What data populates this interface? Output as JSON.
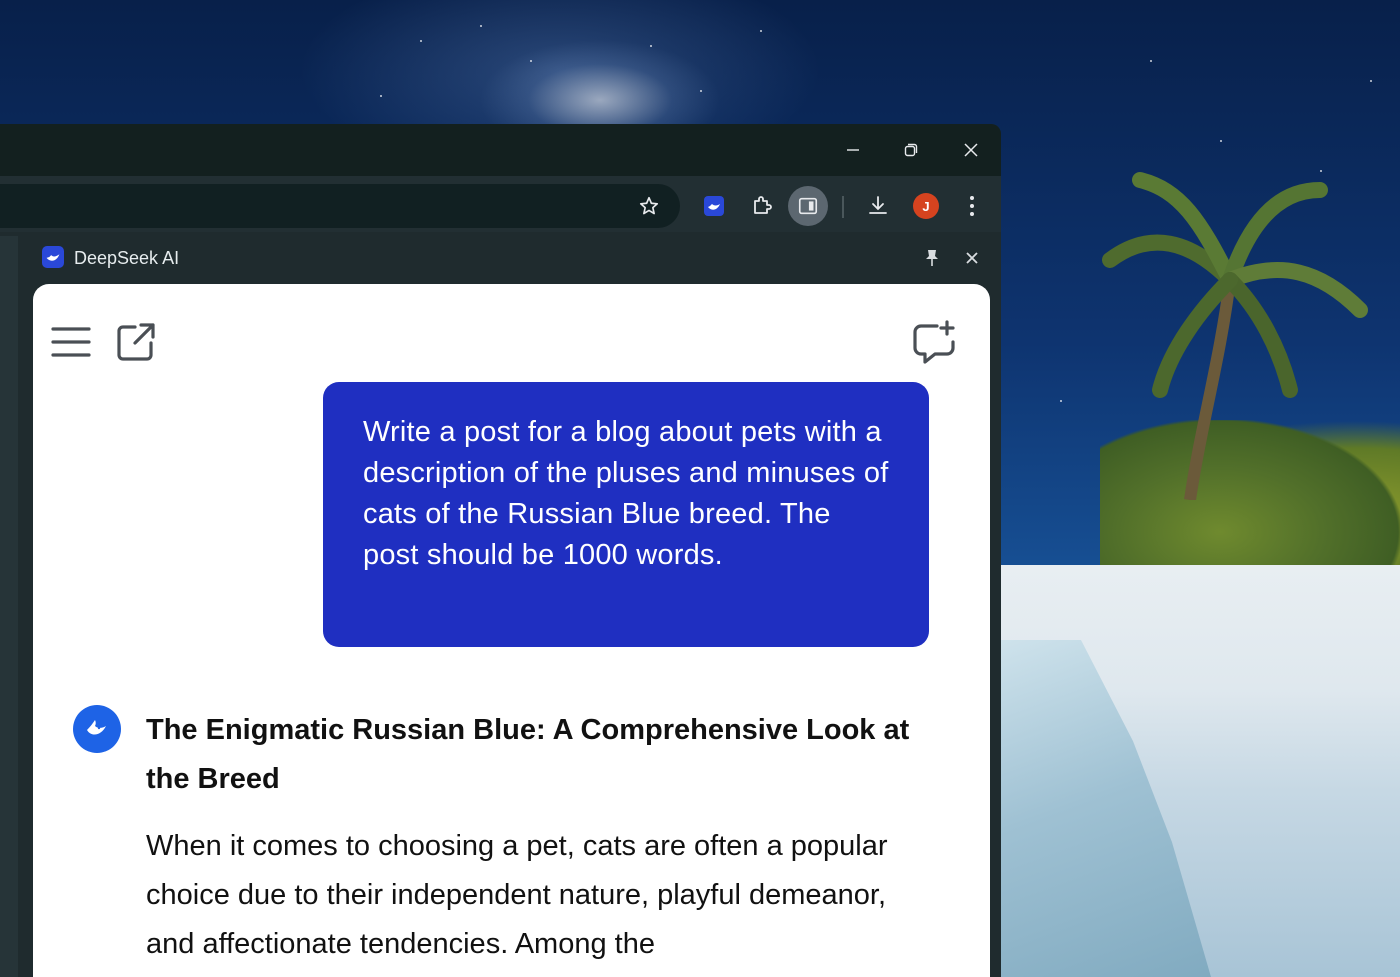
{
  "browser": {
    "profile_initial": "J",
    "side_panel": {
      "title": "DeepSeek AI"
    }
  },
  "chat": {
    "user_message": "Write a post for a blog about pets with a description of the pluses and minuses of cats of the Russian Blue breed. The post should be 1000 words.",
    "answer_title": "The Enigmatic Russian Blue: A Comprehensive Look at the Breed",
    "answer_text": "When it comes to choosing a pet, cats are often a popular choice due to their independent nature, playful demeanor, and affectionate tendencies. Among the"
  },
  "icons": {
    "window": [
      "minimize-icon",
      "restore-icon",
      "close-icon"
    ],
    "toolbar": [
      "star-icon",
      "deepseek-extension-icon",
      "extensions-puzzle-icon",
      "side-panel-icon",
      "download-icon",
      "more-vert-icon"
    ],
    "panel": [
      "menu-icon",
      "open-external-icon",
      "new-chat-icon",
      "pin-icon",
      "close-icon",
      "deepseek-whale-icon"
    ]
  },
  "colors": {
    "user_bubble": "#1f2fc1",
    "brand": "#1e63e6",
    "avatar": "#d6431f"
  }
}
